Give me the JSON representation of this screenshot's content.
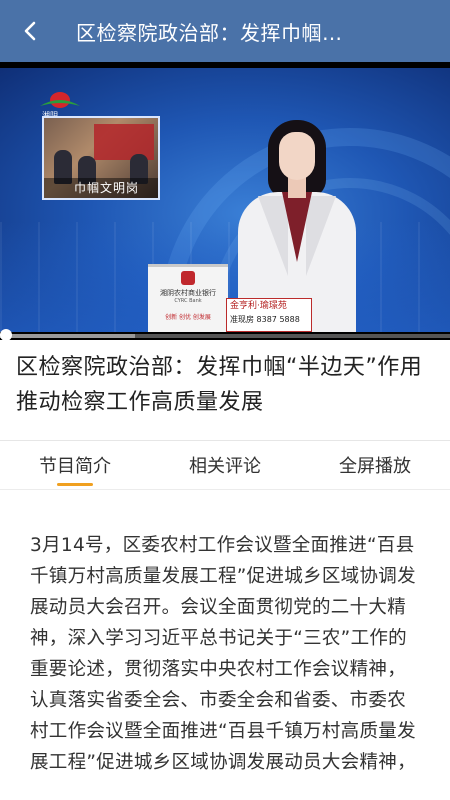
{
  "header": {
    "title": "区检察院政治部：发挥巾帼…",
    "back_icon": "chevron-left-icon",
    "background_color": "#4a72a8"
  },
  "video": {
    "channel_logo": "tv-channel-logo",
    "inset_caption": "巾帼文明岗",
    "sign_bank_name": "湘阴农村商业银行",
    "sign_bank_en": "CYRC Bank",
    "sign_slogan": "创新 创优 创发展",
    "ad_line1": "金亨利·瑜璟苑",
    "ad_line2": "准现房 8387 5888",
    "progress": 0.3
  },
  "article": {
    "title": "区检察院政治部：发挥巾帼“半边天”作用 推动检察工作高质量发展"
  },
  "tabs": [
    {
      "label": "节目简介",
      "active": true
    },
    {
      "label": "相关评论",
      "active": false
    },
    {
      "label": "全屏播放",
      "active": false
    }
  ],
  "accent_color": "#f0a020",
  "description": "3月14号，区委农村工作会议暨全面推进“百县千镇万村高质量发展工程”促进城乡区域协调发展动员大会召开。会议全面贯彻党的二十大精神，深入学习习近平总书记关于“三农”工作的重要论述，贯彻落实中央农村工作会议精神，认真落实省委全会、市委全会和省委、市委农村工作会议暨全面推进“百县千镇万村高质量发展工程”促进城乡区域协调发展动员大会精神，"
}
